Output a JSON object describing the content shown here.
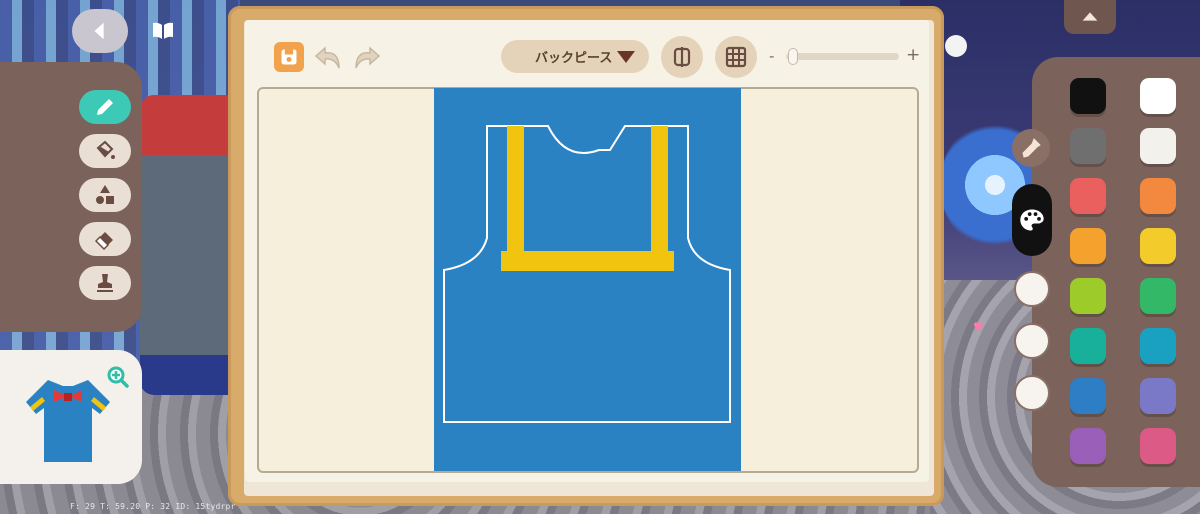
{
  "toolbar": {
    "part_select_label": "バックピース",
    "zoom_minus_label": "-",
    "zoom_plus_label": "+",
    "zoom_level": 0.03
  },
  "colors": {
    "accent_tool": "#3cc9b5",
    "pattern_background": "#2b82c2",
    "pattern_yellow": "#f1c40f",
    "board_wood": "#d9ab6b",
    "panel_brown": "#7b625a"
  },
  "left_tools": [
    {
      "name": "pencil-icon",
      "active": true
    },
    {
      "name": "paint-bucket-icon",
      "active": false
    },
    {
      "name": "shapes-icon",
      "active": false
    },
    {
      "name": "eraser-icon",
      "active": false
    },
    {
      "name": "stamp-icon",
      "active": false
    }
  ],
  "palette": {
    "swatches": [
      {
        "color": "#111111"
      },
      {
        "color": "#ffffff"
      },
      {
        "color": "#6f6f6f"
      },
      {
        "color": "#f3f1ec"
      },
      {
        "color": "#e9605f"
      },
      {
        "color": "#f2893f"
      },
      {
        "color": "#f4a22d"
      },
      {
        "color": "#f3cb2a"
      },
      {
        "color": "#9ccb2a"
      },
      {
        "color": "#33b868"
      },
      {
        "color": "#18b09b"
      },
      {
        "color": "#1aa1c2"
      },
      {
        "color": "#2e7ec6"
      },
      {
        "color": "#7a79c8"
      },
      {
        "color": "#9a5fb8"
      },
      {
        "color": "#db5a86"
      }
    ],
    "empty_slots": 3
  },
  "debug": {
    "text": "F: 29    T: 59.20    P: 32    ID: 15tydrpr"
  }
}
